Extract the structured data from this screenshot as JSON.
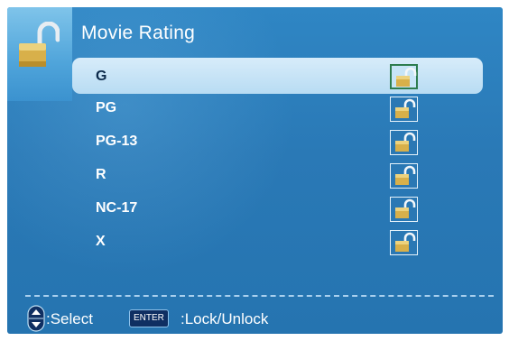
{
  "title": "Movie Rating",
  "ratings": [
    {
      "label": "G",
      "locked": false,
      "selected": true
    },
    {
      "label": "PG",
      "locked": false,
      "selected": false
    },
    {
      "label": "PG-13",
      "locked": false,
      "selected": false
    },
    {
      "label": "R",
      "locked": false,
      "selected": false
    },
    {
      "label": "NC-17",
      "locked": false,
      "selected": false
    },
    {
      "label": "X",
      "locked": false,
      "selected": false
    }
  ],
  "footer": {
    "select_label": ":Select",
    "enter_key": "ENTER",
    "lock_label": ":Lock/Unlock"
  },
  "icons": {
    "header": "padlock-open-icon",
    "row_status": "unlocked-padlock-icon",
    "nav": "up-down-arrows-icon"
  },
  "colors": {
    "panel": "#2a79b6",
    "highlight": "#c7e5f7",
    "lock_gold": "#d8b04a"
  }
}
